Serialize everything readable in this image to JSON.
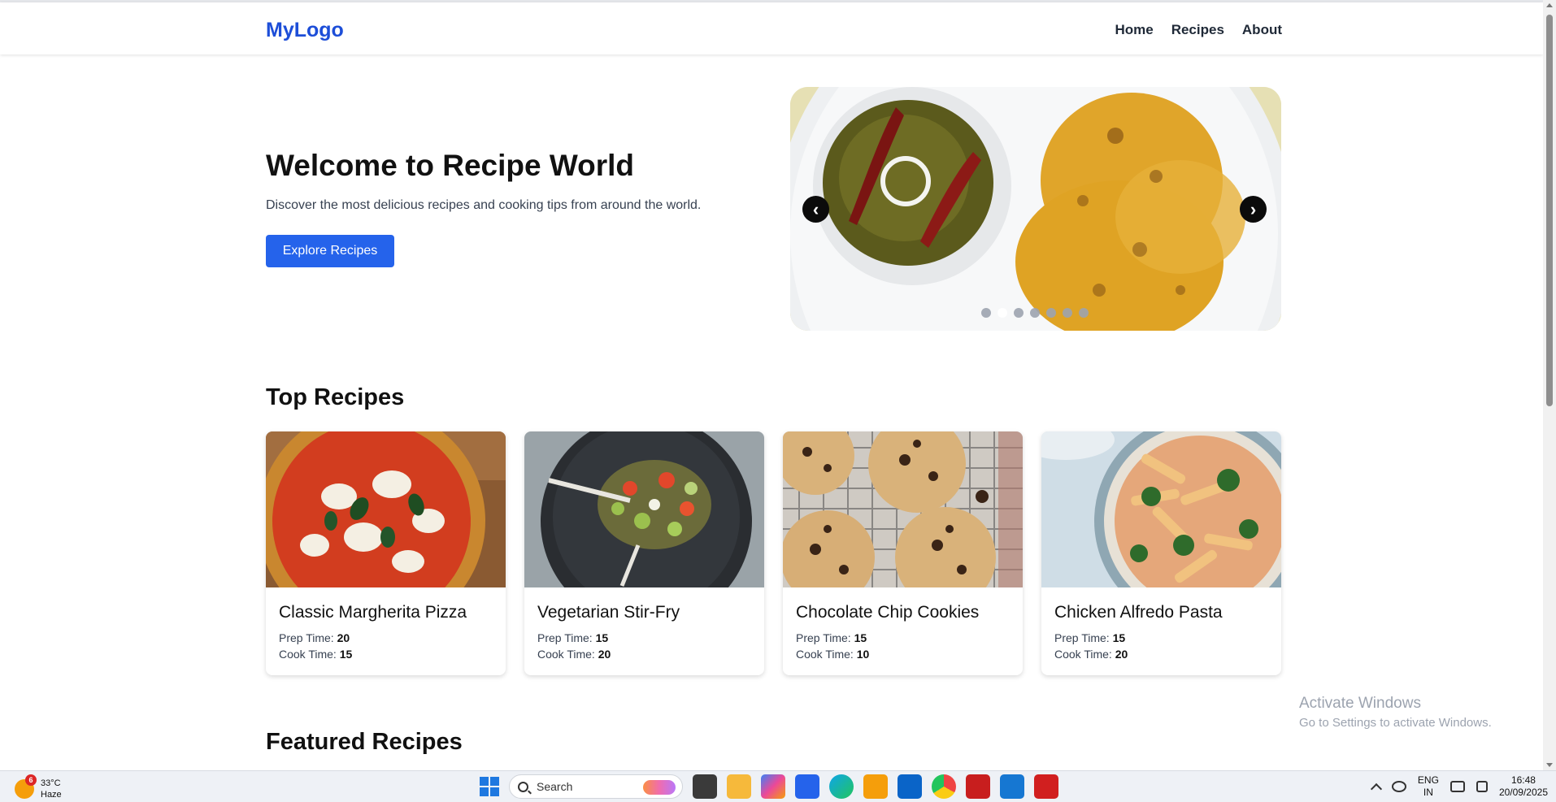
{
  "header": {
    "logo": "MyLogo",
    "nav": [
      "Home",
      "Recipes",
      "About"
    ]
  },
  "hero": {
    "title": "Welcome to Recipe World",
    "subtitle": "Discover the most delicious recipes and cooking tips from around the world.",
    "cta": "Explore Recipes",
    "carousel": {
      "prev_icon": "chevron-left-icon",
      "next_icon": "chevron-right-icon",
      "prev_glyph": "‹",
      "next_glyph": "›",
      "dot_count": 7,
      "active_dot": 2
    }
  },
  "sections": {
    "top_recipes": "Top Recipes",
    "featured_recipes": "Featured Recipes"
  },
  "recipes": [
    {
      "title": "Classic Margherita Pizza",
      "prep_label": "Prep Time:",
      "prep": "20",
      "cook_label": "Cook Time:",
      "cook": "15"
    },
    {
      "title": "Vegetarian Stir-Fry",
      "prep_label": "Prep Time:",
      "prep": "15",
      "cook_label": "Cook Time:",
      "cook": "20"
    },
    {
      "title": "Chocolate Chip Cookies",
      "prep_label": "Prep Time:",
      "prep": "15",
      "cook_label": "Cook Time:",
      "cook": "10"
    },
    {
      "title": "Chicken Alfredo Pasta",
      "prep_label": "Prep Time:",
      "prep": "15",
      "cook_label": "Cook Time:",
      "cook": "20"
    }
  ],
  "watermark": {
    "line1": "Activate Windows",
    "line2": "Go to Settings to activate Windows."
  },
  "taskbar": {
    "weather_temp": "33°C",
    "weather_desc": "Haze",
    "weather_badge": "6",
    "search_placeholder": "Search",
    "lang_line1": "ENG",
    "lang_line2": "IN",
    "time": "16:48",
    "date": "20/09/2025"
  },
  "colors": {
    "brand": "#1d4ed8",
    "button": "#2563eb"
  }
}
